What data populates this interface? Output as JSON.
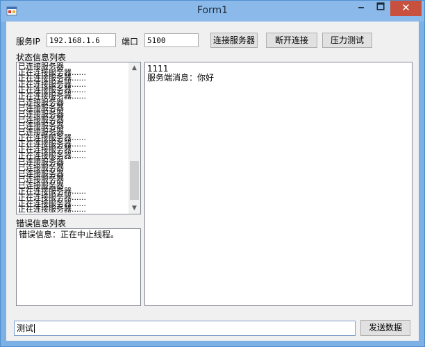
{
  "window": {
    "title": "Form1",
    "min_glyph": "🗕",
    "max_glyph": "🗖",
    "close_glyph": "✕",
    "icon": "winforms-app-icon"
  },
  "connection": {
    "ip_label": "服务IP",
    "ip_value": "192.168.1.6",
    "port_label": "端口",
    "port_value": "5100",
    "connect_label": "连接服务器",
    "disconnect_label": "断开连接",
    "stress_test_label": "压力测试"
  },
  "status_list": {
    "label": "状态信息列表",
    "items": [
      "已连接服务器",
      "正在连接服务器......",
      "正在连接服务器......",
      "正在连接服务器......",
      "正在连接服务器......",
      "正在连接服务器......",
      "已连接服务器",
      "已连接服务器",
      "已连接服务器",
      "已连接服务器",
      "已连接服务器",
      "已连接服务器",
      "正在连接服务器......",
      "正在连接服务器......",
      "正在连接服务器......",
      "正在连接服务器......",
      "已连接服务器",
      "已连接服务器",
      "已连接服务器",
      "已连接服务器",
      "已连接服务器",
      "正在连接服务器......",
      "正在连接服务器......",
      "正在连接服务器......",
      "正在连接服务器......"
    ],
    "scroll_up_glyph": "▲",
    "scroll_down_glyph": "▼"
  },
  "error_list": {
    "label": "错误信息列表",
    "items": [
      "错误信息：正在中止线程。"
    ]
  },
  "messages": {
    "lines": [
      "1111",
      "服务端消息：你好"
    ]
  },
  "send": {
    "input_value": "测试",
    "send_label": "发送数据"
  },
  "colors": {
    "titlebar": "#8bbaea",
    "close_button": "#c7503f",
    "client_bg": "#f0f0f0"
  }
}
